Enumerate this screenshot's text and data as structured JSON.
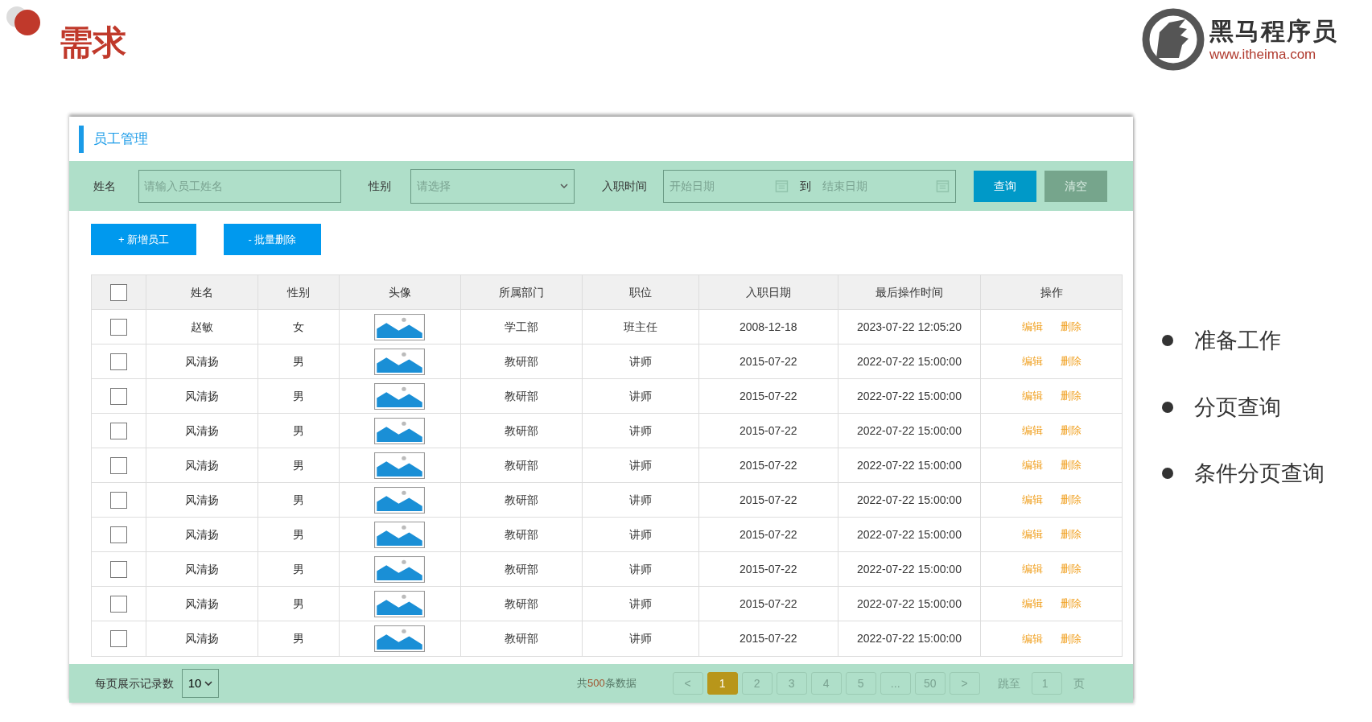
{
  "slide": {
    "title": "需求"
  },
  "logo": {
    "name": "黑马程序员",
    "url": "www.itheima.com"
  },
  "panel": {
    "title": "员工管理",
    "filters": [
      {
        "kind": "text",
        "label": "姓名",
        "placeholder": "请输入员工姓名"
      },
      {
        "kind": "select",
        "label": "性别",
        "placeholder": "请选择"
      },
      {
        "kind": "daterange",
        "label": "入职时间",
        "start_placeholder": "开始日期",
        "separator": "到",
        "end_placeholder": "结束日期"
      }
    ],
    "filter_buttons": [
      {
        "label": "查询",
        "kind": "primary"
      },
      {
        "label": "清空",
        "kind": "secondary"
      }
    ],
    "actions": [
      "+ 新增员工",
      "- 批量删除"
    ],
    "table": {
      "select_all_checked": false,
      "columns": [
        "姓名",
        "性别",
        "头像",
        "所属部门",
        "职位",
        "入职日期",
        "最后操作时间",
        "操作"
      ],
      "rows": [
        {
          "checked": false,
          "name": "赵敏",
          "gender": "女",
          "dept": "学工部",
          "position": "班主任",
          "hired": "2008-12-18",
          "updated": "2023-07-22 12:05:20",
          "edit": "编辑",
          "delete": "删除"
        },
        {
          "checked": false,
          "name": "风清扬",
          "gender": "男",
          "dept": "教研部",
          "position": "讲师",
          "hired": "2015-07-22",
          "updated": "2022-07-22 15:00:00",
          "edit": "编辑",
          "delete": "删除"
        },
        {
          "checked": false,
          "name": "风清扬",
          "gender": "男",
          "dept": "教研部",
          "position": "讲师",
          "hired": "2015-07-22",
          "updated": "2022-07-22 15:00:00",
          "edit": "编辑",
          "delete": "删除"
        },
        {
          "checked": false,
          "name": "风清扬",
          "gender": "男",
          "dept": "教研部",
          "position": "讲师",
          "hired": "2015-07-22",
          "updated": "2022-07-22 15:00:00",
          "edit": "编辑",
          "delete": "删除"
        },
        {
          "checked": false,
          "name": "风清扬",
          "gender": "男",
          "dept": "教研部",
          "position": "讲师",
          "hired": "2015-07-22",
          "updated": "2022-07-22 15:00:00",
          "edit": "编辑",
          "delete": "删除"
        },
        {
          "checked": false,
          "name": "风清扬",
          "gender": "男",
          "dept": "教研部",
          "position": "讲师",
          "hired": "2015-07-22",
          "updated": "2022-07-22 15:00:00",
          "edit": "编辑",
          "delete": "删除"
        },
        {
          "checked": false,
          "name": "风清扬",
          "gender": "男",
          "dept": "教研部",
          "position": "讲师",
          "hired": "2015-07-22",
          "updated": "2022-07-22 15:00:00",
          "edit": "编辑",
          "delete": "删除"
        },
        {
          "checked": false,
          "name": "风清扬",
          "gender": "男",
          "dept": "教研部",
          "position": "讲师",
          "hired": "2015-07-22",
          "updated": "2022-07-22 15:00:00",
          "edit": "编辑",
          "delete": "删除"
        },
        {
          "checked": false,
          "name": "风清扬",
          "gender": "男",
          "dept": "教研部",
          "position": "讲师",
          "hired": "2015-07-22",
          "updated": "2022-07-22 15:00:00",
          "edit": "编辑",
          "delete": "删除"
        },
        {
          "checked": false,
          "name": "风清扬",
          "gender": "男",
          "dept": "教研部",
          "position": "讲师",
          "hired": "2015-07-22",
          "updated": "2022-07-22 15:00:00",
          "edit": "编辑",
          "delete": "删除"
        }
      ]
    },
    "pagination": {
      "page_size_label": "每页展示记录数",
      "page_size": "10",
      "total_text": "共**500**条数据",
      "pages": [
        {
          "label": "<",
          "selected": false
        },
        {
          "label": "1",
          "selected": true
        },
        {
          "label": "2",
          "selected": false
        },
        {
          "label": "3",
          "selected": false
        },
        {
          "label": "4",
          "selected": false
        },
        {
          "label": "5",
          "selected": false
        },
        {
          "label": "...",
          "selected": false
        },
        {
          "label": "50",
          "selected": false
        },
        {
          "label": ">",
          "selected": false
        }
      ],
      "jump_label": "跳至",
      "jump_value": "1",
      "page_unit": "页"
    }
  },
  "bullets": [
    "准备工作",
    "分页查询",
    "条件分页查询"
  ]
}
